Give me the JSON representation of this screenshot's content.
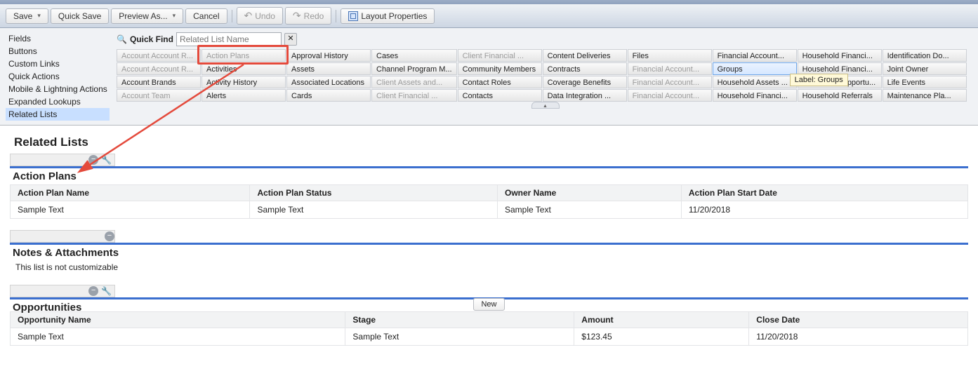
{
  "toolbar": {
    "save": "Save",
    "quick_save": "Quick Save",
    "preview_as": "Preview As...",
    "cancel": "Cancel",
    "undo": "Undo",
    "redo": "Redo",
    "layout_props": "Layout Properties"
  },
  "sidebar": {
    "items": [
      "Fields",
      "Buttons",
      "Custom Links",
      "Quick Actions",
      "Mobile & Lightning Actions",
      "Expanded Lookups",
      "Related Lists"
    ],
    "selected_index": 6
  },
  "quick_find": {
    "label": "Quick Find",
    "placeholder": "Related List Name"
  },
  "palette": {
    "cols": [
      {
        "items": [
          {
            "label": "Account Account R...",
            "inactive": true
          },
          {
            "label": "Account Account R...",
            "inactive": true
          },
          {
            "label": "Account Brands"
          },
          {
            "label": "Account Team",
            "inactive": true
          }
        ]
      },
      {
        "items": [
          {
            "label": "Action Plans",
            "inactive": true
          },
          {
            "label": "Activities"
          },
          {
            "label": "Activity History"
          },
          {
            "label": "Alerts"
          }
        ]
      },
      {
        "items": [
          {
            "label": "Approval History"
          },
          {
            "label": "Assets"
          },
          {
            "label": "Associated Locations"
          },
          {
            "label": "Cards"
          }
        ]
      },
      {
        "items": [
          {
            "label": "Cases"
          },
          {
            "label": "Channel Program M..."
          },
          {
            "label": "Client Assets and...",
            "inactive": true
          },
          {
            "label": "Client Financial ...",
            "inactive": true
          }
        ]
      },
      {
        "items": [
          {
            "label": "Client Financial ...",
            "inactive": true
          },
          {
            "label": "Community Members"
          },
          {
            "label": "Contact Roles"
          },
          {
            "label": "Contacts"
          }
        ]
      },
      {
        "items": [
          {
            "label": "Content Deliveries"
          },
          {
            "label": "Contracts"
          },
          {
            "label": "Coverage Benefits"
          },
          {
            "label": "Data Integration ..."
          }
        ]
      },
      {
        "items": [
          {
            "label": "Files"
          },
          {
            "label": "Financial Account...",
            "inactive": true
          },
          {
            "label": "Financial Account...",
            "inactive": true
          },
          {
            "label": "Financial Account...",
            "inactive": true
          }
        ]
      },
      {
        "items": [
          {
            "label": "Financial Account..."
          },
          {
            "label": "Groups",
            "highlight": true
          },
          {
            "label": "Household Assets ..."
          },
          {
            "label": "Household Financi..."
          }
        ]
      },
      {
        "items": [
          {
            "label": "Household Financi..."
          },
          {
            "label": "Household Financi..."
          },
          {
            "label": "Household Opportu..."
          },
          {
            "label": "Household Referrals"
          }
        ]
      },
      {
        "items": [
          {
            "label": "Identification Do..."
          },
          {
            "label": "Joint Owner"
          },
          {
            "label": "Life Events"
          },
          {
            "label": "Maintenance Pla..."
          }
        ]
      }
    ]
  },
  "tooltip": {
    "text": "Label: Groups"
  },
  "related_lists_heading": "Related Lists",
  "action_plans": {
    "title": "Action Plans",
    "columns": [
      "Action Plan Name",
      "Action Plan Status",
      "Owner Name",
      "Action Plan Start Date"
    ],
    "row": [
      "Sample Text",
      "Sample Text",
      "Sample Text",
      "11/20/2018"
    ]
  },
  "notes": {
    "title": "Notes & Attachments",
    "note": "This list is not customizable"
  },
  "opportunities": {
    "title": "Opportunities",
    "new_btn": "New",
    "columns": [
      "Opportunity Name",
      "Stage",
      "Amount",
      "Close Date"
    ],
    "row": [
      "Sample Text",
      "Sample Text",
      "$123.45",
      "11/20/2018"
    ]
  }
}
